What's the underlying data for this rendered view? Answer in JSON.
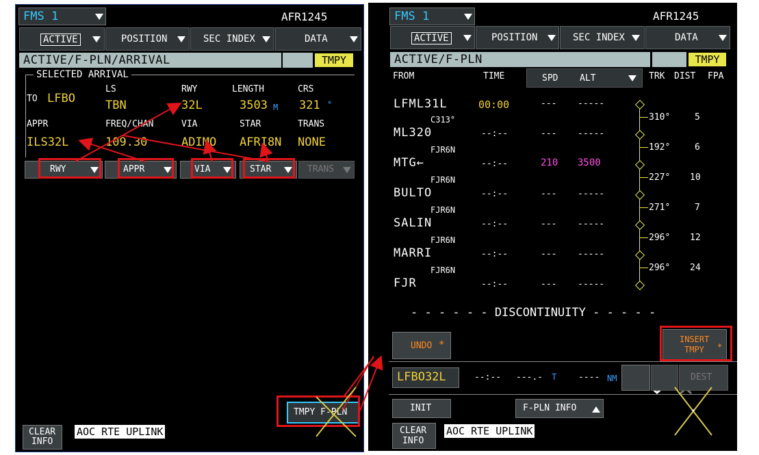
{
  "left": {
    "fms": "FMS 1",
    "callsign": "AFR1245",
    "tabs": {
      "active": "ACTIVE",
      "position": "POSITION",
      "sec_index": "SEC INDEX",
      "data": "DATA"
    },
    "title": "ACTIVE/F-PLN/ARRIVAL",
    "tmpy": "TMPY",
    "selected_arrival": "SELECTED ARRIVAL",
    "to_label": "TO",
    "dest": "LFBO",
    "ls_label": "LS",
    "ls": "TBN",
    "rwy_label": "RWY",
    "rwy": "32L",
    "length_label": "LENGTH",
    "length": "3503",
    "length_unit": "M",
    "crs_label": "CRS",
    "crs": "321",
    "crs_unit": "°",
    "appr_label": "APPR",
    "appr": "ILS32L",
    "freq_label": "FREQ/CHAN",
    "freq": "109.30",
    "via_label": "VIA",
    "via": "ADIMO",
    "star_label": "STAR",
    "star": "AFRI8N",
    "trans_label": "TRANS",
    "trans": "NONE",
    "buttons": {
      "rwy": "RWY",
      "appr": "APPR",
      "via": "VIA",
      "star": "STAR",
      "trans": "TRANS"
    },
    "tmpy_fpln": "TMPY F-PLN",
    "clear_info": [
      "CLEAR",
      "INFO"
    ],
    "aoc": "AOC RTE UPLINK"
  },
  "right": {
    "fms": "FMS 1",
    "callsign": "AFR1245",
    "tabs": {
      "active": "ACTIVE",
      "position": "POSITION",
      "sec_index": "SEC INDEX",
      "data": "DATA"
    },
    "title": "ACTIVE/F-PLN",
    "tmpy": "TMPY",
    "headers": {
      "from": "FROM",
      "time": "TIME",
      "spd": "SPD",
      "alt": "ALT",
      "trk": "TRK",
      "dist": "DIST",
      "fpa": "FPA"
    },
    "rows": [
      {
        "airway": "",
        "wpt": "LFML31L",
        "time": "00:00",
        "spd": "---",
        "alt": "-----",
        "trk": "",
        "dist": ""
      },
      {
        "airway": "C313°",
        "wpt": "ML320",
        "time": "--:--",
        "spd": "---",
        "alt": "-----",
        "trk": "310°",
        "dist": "5"
      },
      {
        "airway": "FJR6N",
        "wpt": "MTG←",
        "time": "--:--",
        "spd": "210",
        "alt": "3500",
        "trk": "192°",
        "dist": "6"
      },
      {
        "airway": "FJR6N",
        "wpt": "BULTO",
        "time": "--:--",
        "spd": "---",
        "alt": "-----",
        "trk": "227°",
        "dist": "10"
      },
      {
        "airway": "FJR6N",
        "wpt": "SALIN",
        "time": "--:--",
        "spd": "---",
        "alt": "-----",
        "trk": "271°",
        "dist": "7"
      },
      {
        "airway": "FJR6N",
        "wpt": "MARRI",
        "time": "--:--",
        "spd": "---",
        "alt": "-----",
        "trk": "296°",
        "dist": "12"
      },
      {
        "airway": "FJR6N",
        "wpt": "FJR",
        "time": "--:--",
        "spd": "---",
        "alt": "-----",
        "trk": "296°",
        "dist": "24"
      }
    ],
    "discontinuity": "- - - - - - DISCONTINUITY - - - - -",
    "undo": "UNDO",
    "star_sym": "*",
    "insert_tmpy": [
      "INSERT",
      "TMPY"
    ],
    "dest_wpt": "LFBO32L",
    "dest_time": "--:--",
    "dest_efob": "---.-",
    "dest_t": "T",
    "dest_dist": "----",
    "dest_nm": "NM",
    "dest_btn": "DEST",
    "init": "INIT",
    "fpln_info": "F-PLN INFO",
    "clear_info": [
      "CLEAR",
      "INFO"
    ],
    "aoc": "AOC RTE UPLINK"
  },
  "colors": {
    "cyan": "#38c8ff",
    "yellow": "#f2d23a",
    "magenta": "#ff4fe0",
    "orange": "#ff8a1e",
    "annotation": "#e0151a"
  }
}
